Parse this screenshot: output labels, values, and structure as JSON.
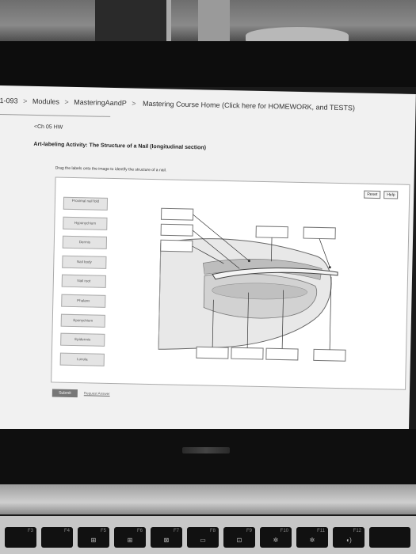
{
  "breadcrumb": {
    "course_id": "1-093",
    "separator": ">",
    "items": [
      "Modules",
      "MasteringAandP",
      "Mastering Course Home (Click here for HOMEWORK, and TESTS)"
    ]
  },
  "back_link": "<Ch 05 HW",
  "activity_title": "Art-labeling Activity: The Structure of a Nail (longitudinal section)",
  "instructions": "Drag the labels onto the image to identify the structure of a nail.",
  "toolbar": {
    "reset": "Reset",
    "help": "Help"
  },
  "labels": [
    "Proximal nail fold",
    "Hyponychium",
    "Dermis",
    "Nail body",
    "Nail root",
    "Phalanx",
    "Eponychium",
    "Epidermis",
    "Lunula"
  ],
  "footer": {
    "submit": "Submit",
    "request_answer": "Request Answer"
  },
  "keyboard": {
    "function_keys": [
      "F3",
      "F4",
      "F5",
      "F6",
      "F7",
      "F8",
      "F9",
      "F10",
      "F11",
      "F12"
    ]
  }
}
